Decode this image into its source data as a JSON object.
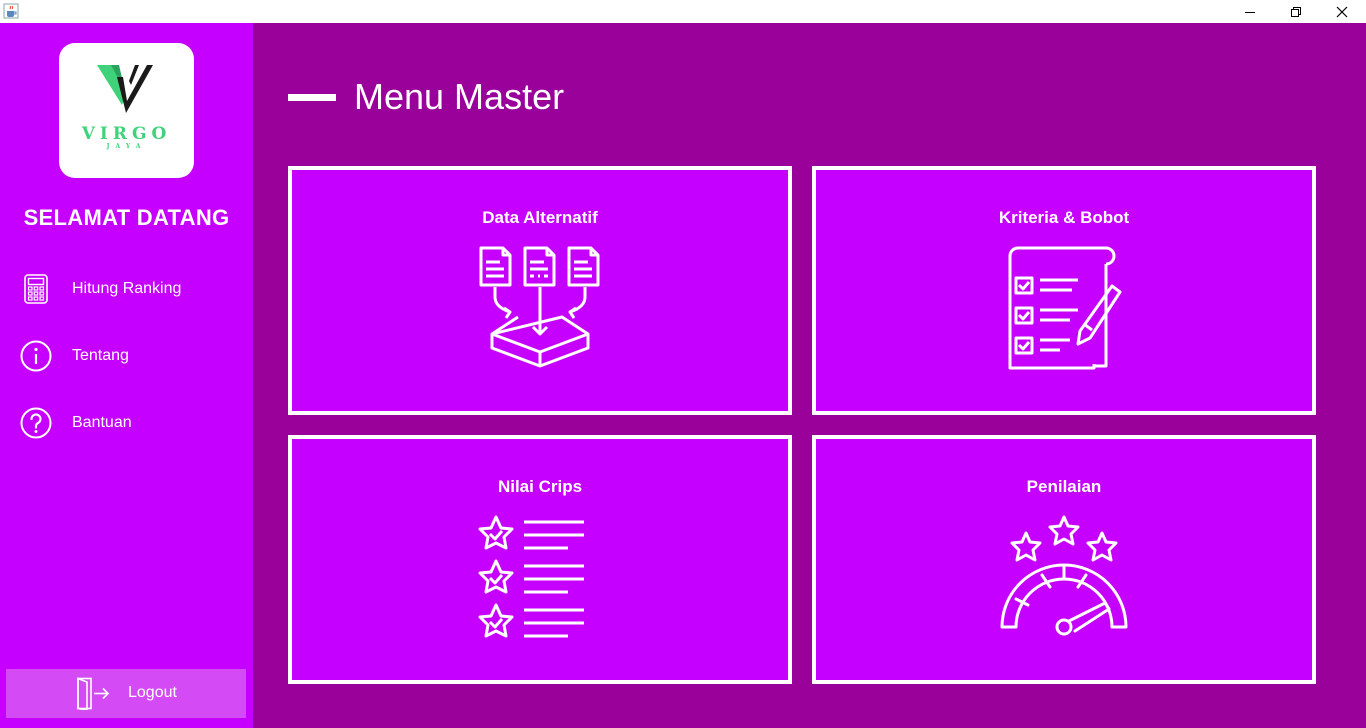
{
  "window": {
    "icon": "java-cup-icon",
    "controls": [
      "minimize-icon",
      "maximize-icon",
      "close-icon"
    ]
  },
  "sidebar": {
    "logo": {
      "brand": "VIRGO",
      "sub": "JAYA"
    },
    "welcome": "SELAMAT DATANG",
    "items": [
      {
        "label": "Hitung Ranking",
        "icon": "calculator-icon"
      },
      {
        "label": "Tentang",
        "icon": "info-icon"
      },
      {
        "label": "Bantuan",
        "icon": "help-icon"
      }
    ],
    "logout": {
      "label": "Logout",
      "icon": "logout-icon"
    }
  },
  "main": {
    "title": "Menu Master",
    "cards": [
      {
        "title": "Data Alternatif",
        "icon": "documents-to-box-icon"
      },
      {
        "title": "Kriteria & Bobot",
        "icon": "checklist-icon"
      },
      {
        "title": "Nilai Crips",
        "icon": "star-list-icon"
      },
      {
        "title": "Penilaian",
        "icon": "rating-gauge-icon"
      }
    ]
  },
  "colors": {
    "sidebar": "#c600ff",
    "main": "#9a009a",
    "card": "#c600ff",
    "logout": "#d44bf5",
    "logo_green": "#3fd27a"
  }
}
